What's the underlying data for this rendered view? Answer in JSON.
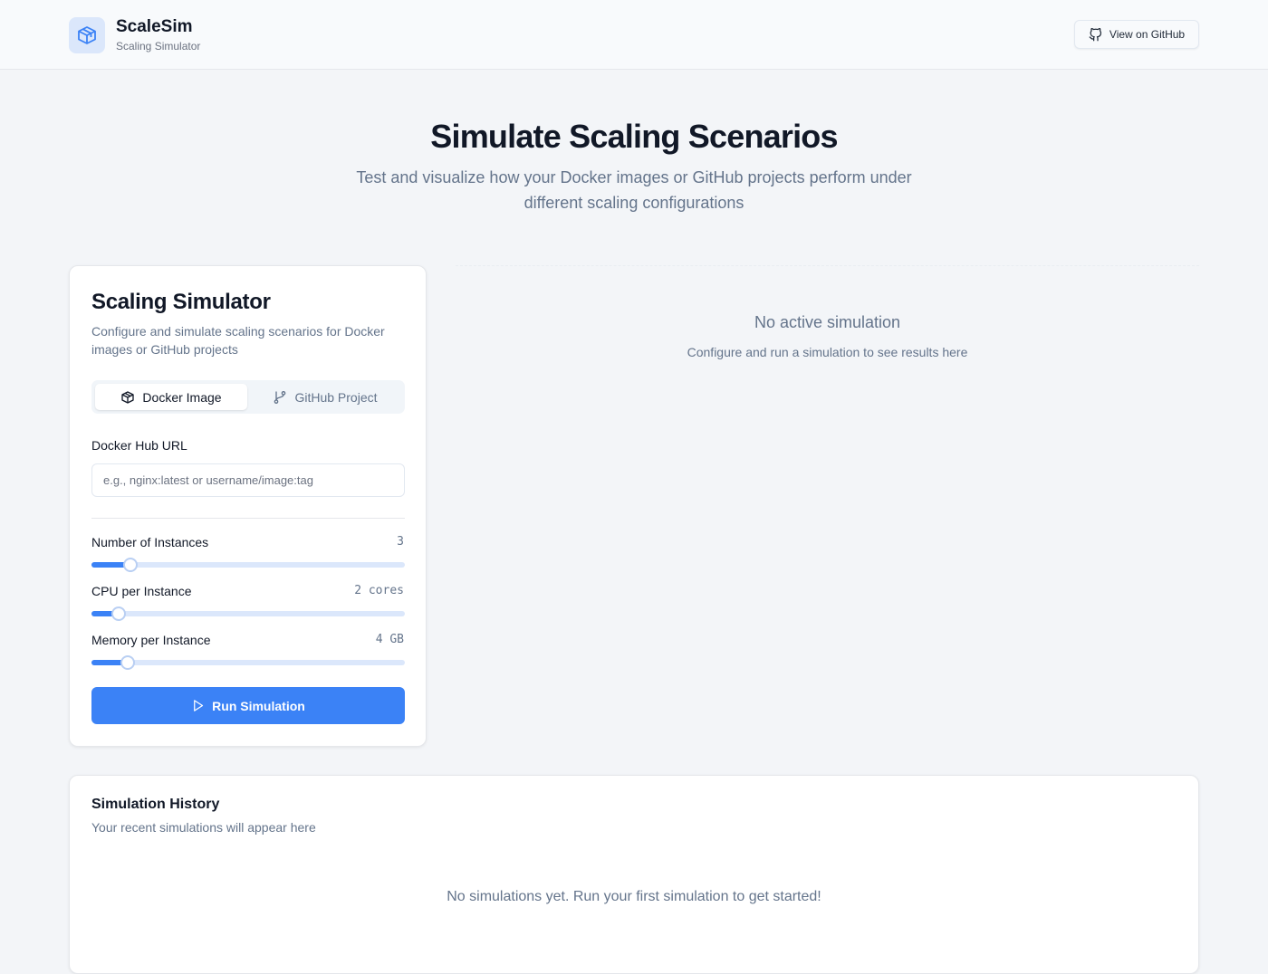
{
  "header": {
    "app_name": "ScaleSim",
    "app_subtitle": "Scaling Simulator",
    "github_button_label": "View on GitHub"
  },
  "hero": {
    "title": "Simulate Scaling Scenarios",
    "subtitle": "Test and visualize how your Docker images or GitHub projects perform under different scaling configurations"
  },
  "simulator": {
    "title": "Scaling Simulator",
    "description": "Configure and simulate scaling scenarios for Docker images or GitHub projects",
    "tabs": [
      {
        "label": "Docker Image",
        "icon": "package-icon",
        "active": true
      },
      {
        "label": "GitHub Project",
        "icon": "git-branch-icon",
        "active": false
      }
    ],
    "url_label": "Docker Hub URL",
    "url_value": "",
    "url_placeholder": "e.g., nginx:latest or username/image:tag",
    "sliders": [
      {
        "label": "Number of Instances",
        "display": "3",
        "level": 0.125
      },
      {
        "label": "CPU per Instance",
        "display": "2 cores",
        "level": 0.087
      },
      {
        "label": "Memory per Instance",
        "display": "4 GB",
        "level": 0.116
      }
    ],
    "run_button_label": "Run Simulation"
  },
  "results": {
    "empty_title": "No active simulation",
    "empty_subtitle": "Configure and run a simulation to see results here"
  },
  "history": {
    "title": "Simulation History",
    "subtitle": "Your recent simulations will appear here",
    "empty_message": "No simulations yet. Run your first simulation to get started!"
  },
  "colors": {
    "accent": "#3b82f6",
    "track": "#dbe7fb",
    "background": "#f3f5f8"
  }
}
